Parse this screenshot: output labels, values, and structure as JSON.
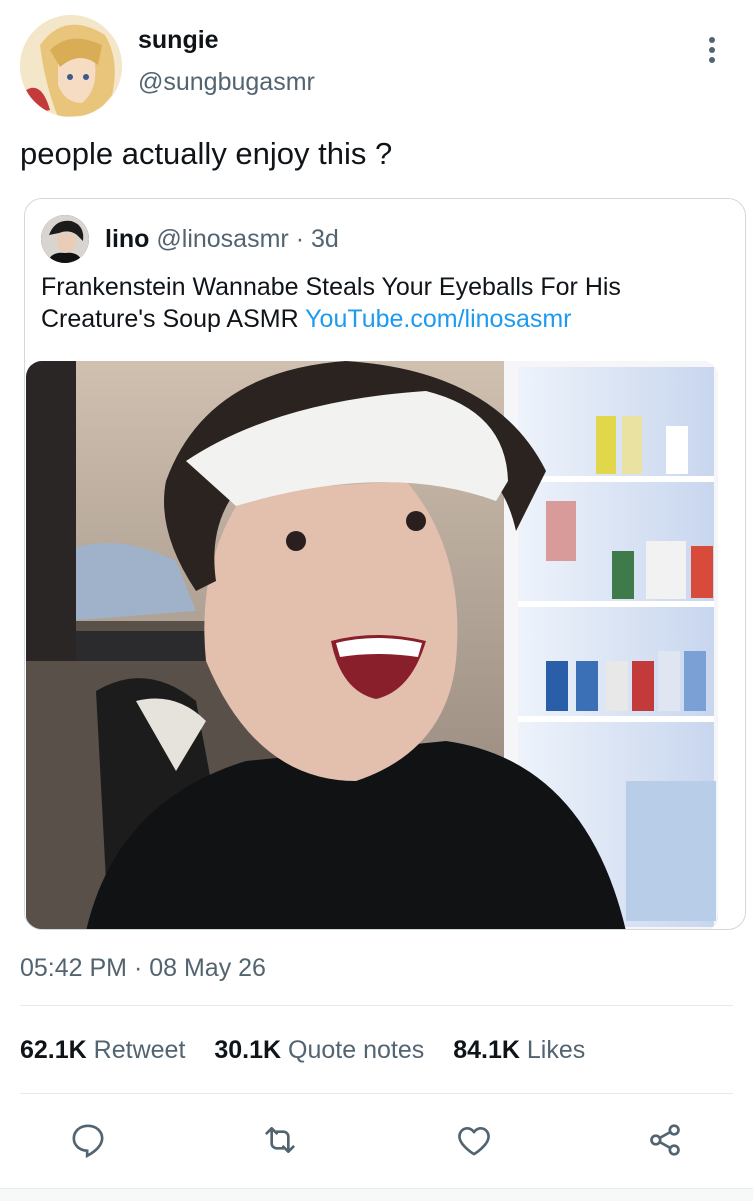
{
  "author": {
    "display_name": "sungie",
    "handle": "@sungbugasmr",
    "avatar_icon": "anime-character-avatar"
  },
  "tweet": {
    "text": "people actually enjoy this ?",
    "timestamp": "05:42 PM · 08 May 26"
  },
  "quoted": {
    "display_name": "lino",
    "handle": "@linosasmr",
    "dot": "·",
    "time_ago": "3d",
    "text": "Frankenstein Wannabe Steals Your Eyeballs For His Creature's Soup ASMR ",
    "link": "YouTube.com/linosasmr",
    "media": "photo of person wearing headband smiling in front of refrigerator"
  },
  "stats": {
    "retweets": {
      "count": "62.1K",
      "label": "Retweet"
    },
    "quotes": {
      "count": "30.1K",
      "label": "Quote notes"
    },
    "likes": {
      "count": "84.1K",
      "label": "Likes"
    }
  },
  "actions": [
    "reply-icon",
    "retweet-icon",
    "like-icon",
    "share-icon"
  ],
  "colors": {
    "text": "#0f1419",
    "secondary": "#536471",
    "link": "#1d9bf0",
    "border": "#cfd9de"
  }
}
